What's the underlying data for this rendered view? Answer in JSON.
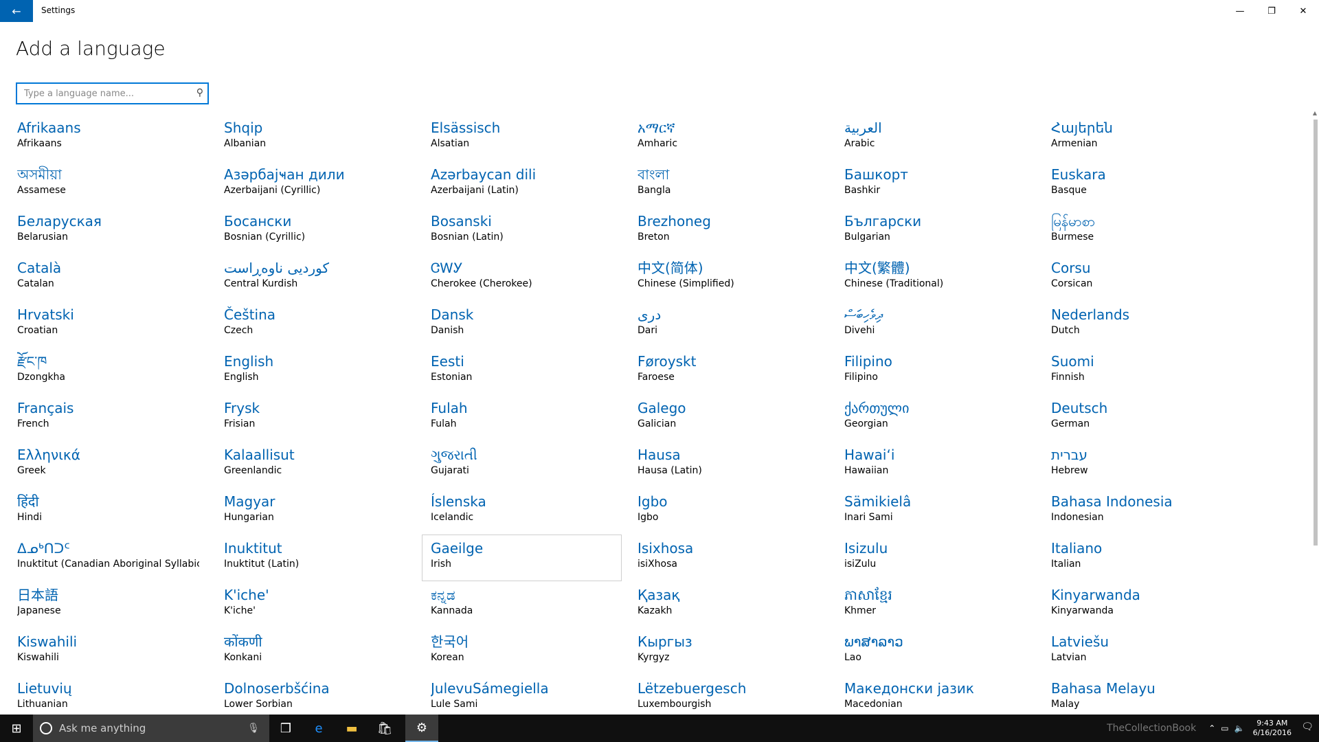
{
  "window": {
    "title": "Settings",
    "back_icon": "←",
    "minimize": "—",
    "restore": "❐",
    "close": "✕"
  },
  "page": {
    "title": "Add a language",
    "search_placeholder": "Type a language name..."
  },
  "languages": [
    {
      "native": "Afrikaans",
      "english": "Afrikaans"
    },
    {
      "native": "Shqip",
      "english": "Albanian"
    },
    {
      "native": "Elsässisch",
      "english": "Alsatian"
    },
    {
      "native": "አማርኛ",
      "english": "Amharic"
    },
    {
      "native": "العربية",
      "english": "Arabic"
    },
    {
      "native": "Հայերեն",
      "english": "Armenian"
    },
    {
      "native": "অসমীয়া",
      "english": "Assamese"
    },
    {
      "native": "Азәрбајҹан дили",
      "english": "Azerbaijani (Cyrillic)"
    },
    {
      "native": "Azərbaycan dili",
      "english": "Azerbaijani (Latin)"
    },
    {
      "native": "বাংলা",
      "english": "Bangla"
    },
    {
      "native": "Башкорт",
      "english": "Bashkir"
    },
    {
      "native": "Euskara",
      "english": "Basque"
    },
    {
      "native": "Беларуская",
      "english": "Belarusian"
    },
    {
      "native": "Босански",
      "english": "Bosnian (Cyrillic)"
    },
    {
      "native": "Bosanski",
      "english": "Bosnian (Latin)"
    },
    {
      "native": "Brezhoneg",
      "english": "Breton"
    },
    {
      "native": "Български",
      "english": "Bulgarian"
    },
    {
      "native": "မြန်မာစာ",
      "english": "Burmese"
    },
    {
      "native": "Català",
      "english": "Catalan"
    },
    {
      "native": "کوردیی ناوەڕاست",
      "english": "Central Kurdish"
    },
    {
      "native": "ᏣᎳᎩ",
      "english": "Cherokee (Cherokee)"
    },
    {
      "native": "中文(简体)",
      "english": "Chinese (Simplified)"
    },
    {
      "native": "中文(繁體)",
      "english": "Chinese (Traditional)"
    },
    {
      "native": "Corsu",
      "english": "Corsican"
    },
    {
      "native": "Hrvatski",
      "english": "Croatian"
    },
    {
      "native": "Čeština",
      "english": "Czech"
    },
    {
      "native": "Dansk",
      "english": "Danish"
    },
    {
      "native": "درى",
      "english": "Dari"
    },
    {
      "native": "ދިވެހިބަސް",
      "english": "Divehi"
    },
    {
      "native": "Nederlands",
      "english": "Dutch"
    },
    {
      "native": "རྫོང་ཁ",
      "english": "Dzongkha"
    },
    {
      "native": "English",
      "english": "English"
    },
    {
      "native": "Eesti",
      "english": "Estonian"
    },
    {
      "native": "Føroyskt",
      "english": "Faroese"
    },
    {
      "native": "Filipino",
      "english": "Filipino"
    },
    {
      "native": "Suomi",
      "english": "Finnish"
    },
    {
      "native": "Français",
      "english": "French"
    },
    {
      "native": "Frysk",
      "english": "Frisian"
    },
    {
      "native": "Fulah",
      "english": "Fulah"
    },
    {
      "native": "Galego",
      "english": "Galician"
    },
    {
      "native": "ქართული",
      "english": "Georgian"
    },
    {
      "native": "Deutsch",
      "english": "German"
    },
    {
      "native": "Ελληνικά",
      "english": "Greek"
    },
    {
      "native": "Kalaallisut",
      "english": "Greenlandic"
    },
    {
      "native": "ગુજરાતી",
      "english": "Gujarati"
    },
    {
      "native": "Hausa",
      "english": "Hausa (Latin)"
    },
    {
      "native": "Hawaiʻi",
      "english": "Hawaiian"
    },
    {
      "native": "עברית",
      "english": "Hebrew"
    },
    {
      "native": "हिंदी",
      "english": "Hindi"
    },
    {
      "native": "Magyar",
      "english": "Hungarian"
    },
    {
      "native": "Íslenska",
      "english": "Icelandic"
    },
    {
      "native": "Igbo",
      "english": "Igbo"
    },
    {
      "native": "Sämikielâ",
      "english": "Inari Sami"
    },
    {
      "native": "Bahasa Indonesia",
      "english": "Indonesian"
    },
    {
      "native": "ᐃᓄᒃᑎᑐᑦ",
      "english": "Inuktitut (Canadian Aboriginal Syllabics)"
    },
    {
      "native": "Inuktitut",
      "english": "Inuktitut (Latin)"
    },
    {
      "native": "Gaeilge",
      "english": "Irish"
    },
    {
      "native": "Isixhosa",
      "english": "isiXhosa"
    },
    {
      "native": "Isizulu",
      "english": "isiZulu"
    },
    {
      "native": "Italiano",
      "english": "Italian"
    },
    {
      "native": "日本語",
      "english": "Japanese"
    },
    {
      "native": "K'iche'",
      "english": "K'iche'"
    },
    {
      "native": "ಕನ್ನಡ",
      "english": "Kannada"
    },
    {
      "native": "Қазақ",
      "english": "Kazakh"
    },
    {
      "native": "ភាសាខ្មែរ",
      "english": "Khmer"
    },
    {
      "native": "Kinyarwanda",
      "english": "Kinyarwanda"
    },
    {
      "native": "Kiswahili",
      "english": "Kiswahili"
    },
    {
      "native": "कोंकणी",
      "english": "Konkani"
    },
    {
      "native": "한국어",
      "english": "Korean"
    },
    {
      "native": "Кыргыз",
      "english": "Kyrgyz"
    },
    {
      "native": "ພາສາລາວ",
      "english": "Lao"
    },
    {
      "native": "Latviešu",
      "english": "Latvian"
    },
    {
      "native": "Lietuvių",
      "english": "Lithuanian"
    },
    {
      "native": "Dolnoserbšćina",
      "english": "Lower Sorbian"
    },
    {
      "native": "JulevuSámegiella",
      "english": "Lule Sami"
    },
    {
      "native": "Lëtzebuergesch",
      "english": "Luxembourgish"
    },
    {
      "native": "Македонски јазик",
      "english": "Macedonian"
    },
    {
      "native": "Bahasa Melayu",
      "english": "Malay"
    }
  ],
  "selected_index": 56,
  "taskbar": {
    "search_placeholder": "Ask me anything",
    "time": "9:43 AM",
    "date": "6/16/2016",
    "watermark": "TheCollectionBook"
  }
}
